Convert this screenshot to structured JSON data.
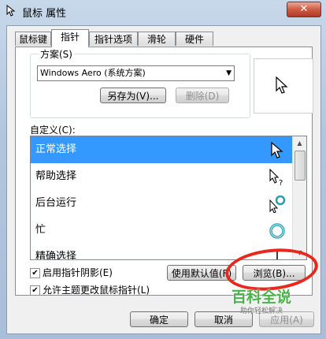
{
  "window": {
    "title": "鼠标 属性",
    "close_glyph": "✕"
  },
  "tabs": [
    {
      "label": "鼠标键"
    },
    {
      "label": "指针"
    },
    {
      "label": "指针选项"
    },
    {
      "label": "滑轮"
    },
    {
      "label": "硬件"
    }
  ],
  "scheme": {
    "legend": "方案(S)",
    "selected": "Windows Aero (系统方案)",
    "save_as_label": "另存为(V)...",
    "delete_label": "删除(D)"
  },
  "customize": {
    "label": "自定义(C):",
    "items": [
      {
        "label": "正常选择",
        "icon": "arrow-cursor-icon"
      },
      {
        "label": "帮助选择",
        "icon": "help-cursor-icon"
      },
      {
        "label": "后台运行",
        "icon": "working-cursor-icon"
      },
      {
        "label": "忙",
        "icon": "busy-cursor-icon"
      },
      {
        "label": "精确选择",
        "icon": "precision-cursor-icon"
      }
    ]
  },
  "options": {
    "shadow_label": "启用指针阴影(E)",
    "shadow_checked": true,
    "theme_label": "允许主题更改鼠标指针(L)",
    "theme_checked": true
  },
  "buttons": {
    "use_default": "使用默认值(F)",
    "browse": "浏览(B)...",
    "ok": "确定",
    "cancel": "取消",
    "apply": "应用(A)"
  },
  "watermark": {
    "main": "百科全说",
    "sub": "助你轻松解决"
  },
  "colors": {
    "selection": "#3399ff",
    "annotation_red": "#e8281d",
    "watermark_green": "#4ab34a"
  }
}
